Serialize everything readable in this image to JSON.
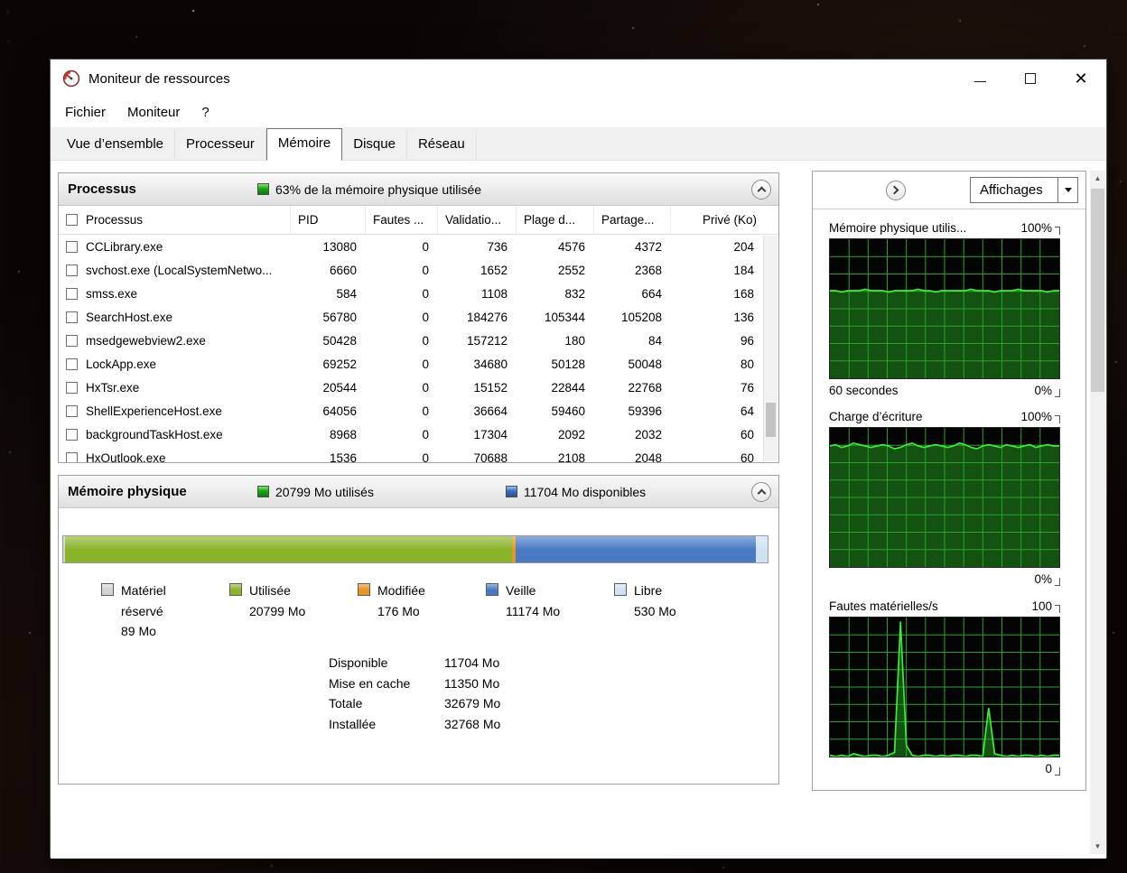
{
  "window": {
    "title": "Moniteur de ressources"
  },
  "menu": {
    "items": [
      "Fichier",
      "Moniteur",
      "?"
    ]
  },
  "tabs": {
    "items": [
      {
        "label": "Vue d’ensemble",
        "active": false
      },
      {
        "label": "Processeur",
        "active": false
      },
      {
        "label": "Mémoire",
        "active": true
      },
      {
        "label": "Disque",
        "active": false
      },
      {
        "label": "Réseau",
        "active": false
      }
    ]
  },
  "processes": {
    "title": "Processus",
    "status": "63% de la mémoire physique utilisée",
    "columns": [
      "Processus",
      "PID",
      "Fautes ...",
      "Validatio...",
      "Plage d...",
      "Partage...",
      "Privé (Ko)"
    ],
    "rows": [
      [
        "CCLibrary.exe",
        "13080",
        "0",
        "736",
        "4576",
        "4372",
        "204"
      ],
      [
        "svchost.exe (LocalSystemNetwo...",
        "6660",
        "0",
        "1652",
        "2552",
        "2368",
        "184"
      ],
      [
        "smss.exe",
        "584",
        "0",
        "1108",
        "832",
        "664",
        "168"
      ],
      [
        "SearchHost.exe",
        "56780",
        "0",
        "184276",
        "105344",
        "105208",
        "136"
      ],
      [
        "msedgewebview2.exe",
        "50428",
        "0",
        "157212",
        "180",
        "84",
        "96"
      ],
      [
        "LockApp.exe",
        "69252",
        "0",
        "34680",
        "50128",
        "50048",
        "80"
      ],
      [
        "HxTsr.exe",
        "20544",
        "0",
        "15152",
        "22844",
        "22768",
        "76"
      ],
      [
        "ShellExperienceHost.exe",
        "64056",
        "0",
        "36664",
        "59460",
        "59396",
        "64"
      ],
      [
        "backgroundTaskHost.exe",
        "8968",
        "0",
        "17304",
        "2092",
        "2032",
        "60"
      ],
      [
        "HxOutlook.exe",
        "1536",
        "0",
        "70688",
        "2108",
        "2048",
        "60"
      ]
    ]
  },
  "memory": {
    "title": "Mémoire physique",
    "used_label": "20799 Mo utilisés",
    "available_label": "11704 Mo disponibles",
    "total_mb": 32768,
    "segments": [
      {
        "name": "Matériel réservé",
        "value": 89,
        "color": "#d2d2d2"
      },
      {
        "name": "Utilisée",
        "value": 20799,
        "color": "#8ab42a"
      },
      {
        "name": "Modifiée",
        "value": 176,
        "color": "#e8941e"
      },
      {
        "name": "Veille",
        "value": 11174,
        "color": "#4779c4"
      },
      {
        "name": "Libre",
        "value": 530,
        "color": "#cfe2f3"
      }
    ],
    "legend": [
      {
        "lines": [
          "Matériel",
          "réservé"
        ],
        "value": "89 Mo",
        "color": "#d2d2d2"
      },
      {
        "lines": [
          "Utilisée"
        ],
        "value": "20799 Mo",
        "color": "#8ab42a"
      },
      {
        "lines": [
          "Modifiée"
        ],
        "value": "176 Mo",
        "color": "#e8941e"
      },
      {
        "lines": [
          "Veille"
        ],
        "value": "11174 Mo",
        "color": "#4779c4"
      },
      {
        "lines": [
          "Libre"
        ],
        "value": "530 Mo",
        "color": "#cfe2f3"
      }
    ],
    "stats": [
      {
        "label": "Disponible",
        "value": "11704 Mo"
      },
      {
        "label": "Mise en cache",
        "value": "11350 Mo"
      },
      {
        "label": "Totale",
        "value": "32679 Mo"
      },
      {
        "label": "Installée",
        "value": "32768 Mo"
      }
    ]
  },
  "sidebar": {
    "views_label": "Affichages",
    "graphs": [
      {
        "title": "Mémoire physique utilis...",
        "max": "100%",
        "min": "0%",
        "x_label": "60 secondes",
        "values": [
          63,
          63,
          62,
          63,
          63,
          63,
          64,
          63,
          63,
          63,
          62,
          63,
          63,
          63,
          63,
          64,
          63,
          63,
          62,
          63,
          63,
          63,
          63,
          63,
          64,
          63,
          63,
          63,
          62,
          63,
          63,
          63,
          64,
          63,
          63,
          63,
          63,
          62,
          63,
          63
        ]
      },
      {
        "title": "Charge d’écriture",
        "max": "100%",
        "min": "0%",
        "x_label": "",
        "values": [
          87,
          88,
          86,
          87,
          89,
          88,
          87,
          86,
          87,
          88,
          87,
          85,
          86,
          88,
          89,
          87,
          86,
          87,
          88,
          87,
          86,
          87,
          89,
          88,
          86,
          85,
          87,
          88,
          87,
          86,
          88,
          87,
          86,
          87,
          88,
          86,
          87,
          88,
          87,
          87
        ]
      },
      {
        "title": "Fautes matérielles/s",
        "max": "100",
        "min": "0",
        "x_label": "",
        "values": [
          1,
          0,
          1,
          0,
          2,
          1,
          0,
          1,
          1,
          0,
          1,
          3,
          97,
          8,
          1,
          0,
          1,
          1,
          0,
          1,
          0,
          1,
          1,
          0,
          1,
          1,
          0,
          35,
          2,
          1,
          0,
          1,
          0,
          1,
          1,
          0,
          1,
          0,
          1,
          1
        ]
      }
    ]
  }
}
